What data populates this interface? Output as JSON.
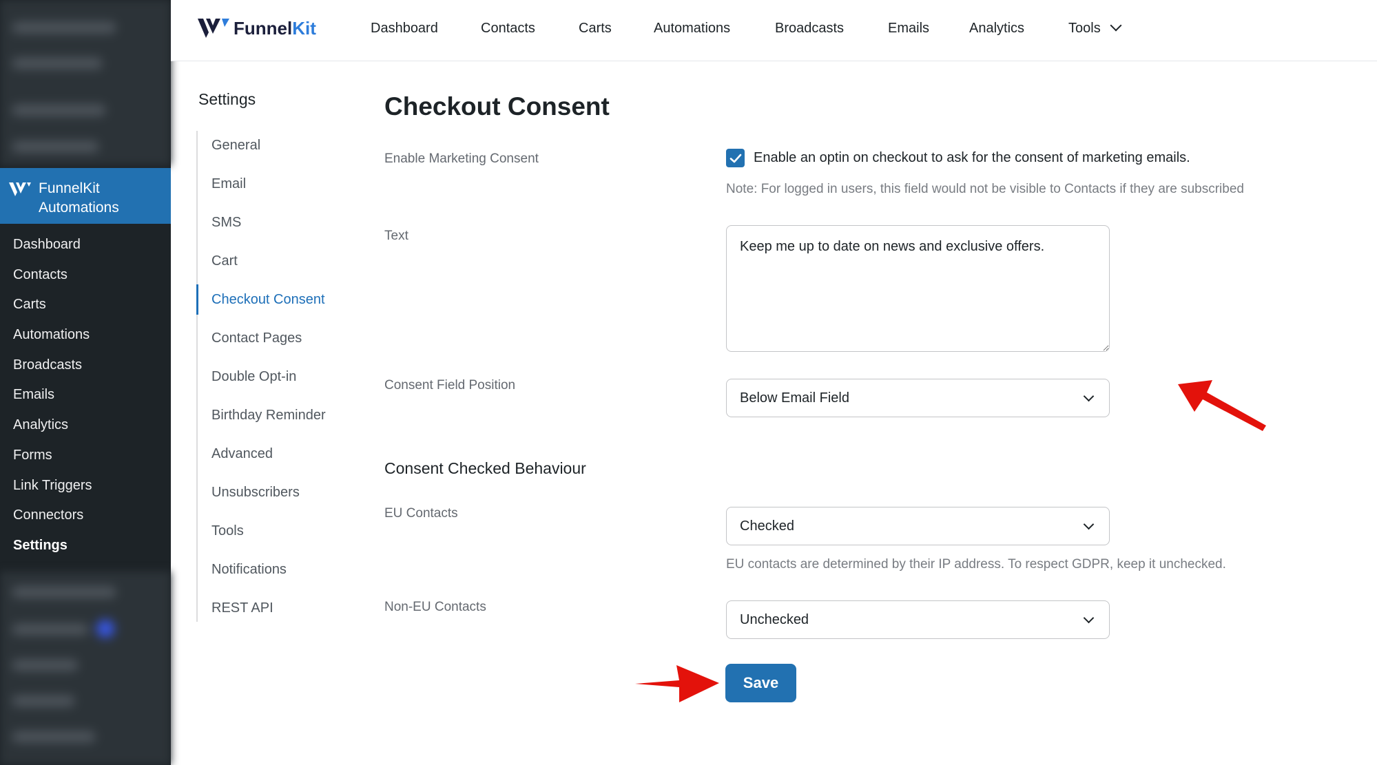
{
  "wp_sidebar": {
    "brand_line1": "FunnelKit",
    "brand_line2": "Automations",
    "items": [
      {
        "label": "Dashboard"
      },
      {
        "label": "Contacts"
      },
      {
        "label": "Carts"
      },
      {
        "label": "Automations"
      },
      {
        "label": "Broadcasts"
      },
      {
        "label": "Emails"
      },
      {
        "label": "Analytics"
      },
      {
        "label": "Forms"
      },
      {
        "label": "Link Triggers"
      },
      {
        "label": "Connectors"
      },
      {
        "label": "Settings"
      }
    ],
    "current": "Settings"
  },
  "header": {
    "logo_text_main": "Funnel",
    "logo_text_accent": "Kit",
    "nav": [
      {
        "label": "Dashboard"
      },
      {
        "label": "Contacts"
      },
      {
        "label": "Carts"
      },
      {
        "label": "Automations"
      },
      {
        "label": "Broadcasts"
      },
      {
        "label": "Emails"
      },
      {
        "label": "Analytics"
      },
      {
        "label": "Tools"
      }
    ]
  },
  "settings_nav": {
    "title": "Settings",
    "items": [
      {
        "label": "General"
      },
      {
        "label": "Email"
      },
      {
        "label": "SMS"
      },
      {
        "label": "Cart"
      },
      {
        "label": "Checkout Consent"
      },
      {
        "label": "Contact Pages"
      },
      {
        "label": "Double Opt-in"
      },
      {
        "label": "Birthday Reminder"
      },
      {
        "label": "Advanced"
      },
      {
        "label": "Unsubscribers"
      },
      {
        "label": "Tools"
      },
      {
        "label": "Notifications"
      },
      {
        "label": "REST API"
      }
    ],
    "active": "Checkout Consent"
  },
  "main": {
    "title": "Checkout Consent",
    "marketing_consent": {
      "label": "Enable Marketing Consent",
      "checked": true,
      "checkbox_label": "Enable an optin on checkout to ask for the consent of marketing emails.",
      "note": "Note: For logged in users, this field would not be visible to Contacts if they are subscribed"
    },
    "text_field": {
      "label": "Text",
      "value": "Keep me up to date on news and exclusive offers."
    },
    "position_field": {
      "label": "Consent Field Position",
      "value": "Below Email Field"
    },
    "behaviour_section": {
      "title": "Consent Checked Behaviour",
      "eu": {
        "label": "EU Contacts",
        "value": "Checked",
        "note": "EU contacts are determined by their IP address. To respect GDPR, keep it unchecked."
      },
      "non_eu": {
        "label": "Non-EU Contacts",
        "value": "Unchecked"
      }
    },
    "save_label": "Save"
  },
  "colors": {
    "primary": "#2271b1",
    "sidebar_bg": "#1d2327",
    "active_link": "#1d6fb8",
    "arrow_red": "#e3120b"
  },
  "icons": {
    "brand": "funnelkit-logo-icon",
    "checkbox": "checkmark-icon",
    "dropdown": "chevron-down-icon",
    "annotation": "red-arrow-icon"
  }
}
